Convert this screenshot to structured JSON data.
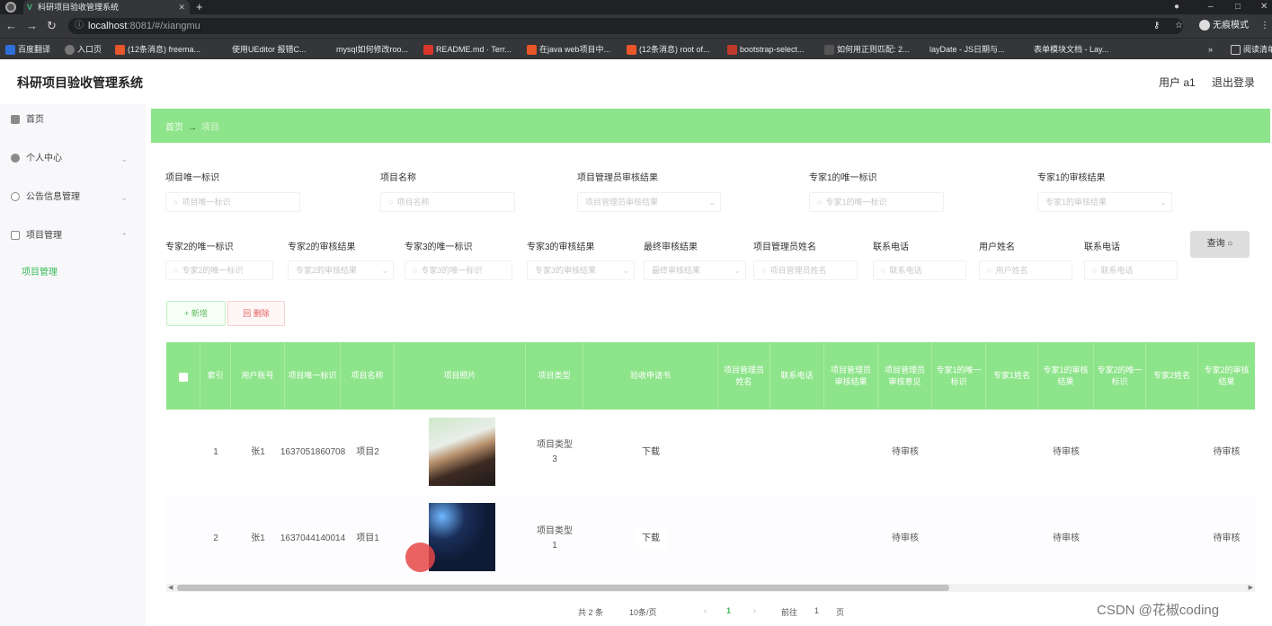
{
  "browser": {
    "tab_title": "科研项目验收管理系统",
    "tab_logo": "V",
    "url_host": "localhost",
    "url_rest": ":8081/#/xiangmu",
    "incognito_label": "无痕模式",
    "bookmarks": [
      {
        "label": "百度翻译",
        "color": "#2f6fd8"
      },
      {
        "label": "入口页",
        "color": "#777777"
      },
      {
        "label": "(12条消息) freema...",
        "color": "#e8562a"
      },
      {
        "label": "使用UEditor 报错C...",
        "color": "#35363a"
      },
      {
        "label": "mysql如何修改roo...",
        "color": "#35363a"
      },
      {
        "label": "README.md · Terr...",
        "color": "#d9362b"
      },
      {
        "label": "在java web项目中...",
        "color": "#e8562a"
      },
      {
        "label": "(12条消息) root of...",
        "color": "#e8562a"
      },
      {
        "label": "bootstrap-select...",
        "color": "#c0392b"
      },
      {
        "label": "如何用正则匹配: 2...",
        "color": "#555555"
      },
      {
        "label": "layDate - JS日期与...",
        "color": "#35363a"
      },
      {
        "label": "表单模块文档 - Lay...",
        "color": "#35363a"
      },
      {
        "label": "阅读清单",
        "color": "#35363a"
      }
    ]
  },
  "header": {
    "title": "科研项目验收管理系统",
    "user": "用户 a1",
    "logout": "退出登录"
  },
  "sidebar": {
    "items": [
      {
        "label": "首页"
      },
      {
        "label": "个人中心"
      },
      {
        "label": "公告信息管理"
      },
      {
        "label": "项目管理"
      }
    ],
    "sub_item": "项目管理"
  },
  "breadcrumb": {
    "home": "首页",
    "arrow": "→",
    "current": "项目"
  },
  "filters": {
    "row1": [
      {
        "label": "项目唯一标识",
        "placeholder": "项目唯一标识"
      },
      {
        "label": "项目名称",
        "placeholder": "项目名称"
      },
      {
        "label": "项目管理员审核结果",
        "placeholder": "项目管理员审核结果"
      },
      {
        "label": "专家1的唯一标识",
        "placeholder": "专家1的唯一标识"
      },
      {
        "label": "专家1的审核结果",
        "placeholder": "专家1的审核结果"
      }
    ],
    "row2": [
      {
        "label": "专家2的唯一标识",
        "placeholder": "专家2的唯一标识"
      },
      {
        "label": "专家2的审核结果",
        "placeholder": "专家2的审核结果"
      },
      {
        "label": "专家3的唯一标识",
        "placeholder": "专家3的唯一标识"
      },
      {
        "label": "专家3的审核结果",
        "placeholder": "专家3的审核结果"
      },
      {
        "label": "最终审核结果",
        "placeholder": "最终审核结果"
      },
      {
        "label": "项目管理员姓名",
        "placeholder": "项目管理员姓名"
      },
      {
        "label": "联系电话",
        "placeholder": "联系电话"
      },
      {
        "label": "用户姓名",
        "placeholder": "用户姓名"
      },
      {
        "label": "联系电话",
        "placeholder": "联系电话"
      }
    ],
    "query_label": "查询 ○"
  },
  "actions": {
    "add": "+ 新增",
    "delete": "回 删除"
  },
  "table": {
    "columns": [
      "索引",
      "用户账号",
      "项目唯一标识",
      "项目名称",
      "项目照片",
      "项目类型",
      "验收申请书",
      "项目管理员姓名",
      "联系电话",
      "项目管理员审核结果",
      "项目管理员审核意见",
      "专家1的唯一标识",
      "专家1姓名",
      "专家1的审核结果",
      "专家2的唯一标识",
      "专家2姓名",
      "专家2的审核结果"
    ],
    "rows": [
      {
        "index": "1",
        "account": "张1",
        "uid": "1637051860708",
        "name": "项目2",
        "type": "项目类型3",
        "download": "下载",
        "admin_result": "待审核",
        "expert1_result": "待审核",
        "expert2_result": "待审核"
      },
      {
        "index": "2",
        "account": "张1",
        "uid": "1637044140014",
        "name": "项目1",
        "type": "项目类型1",
        "download": "下载",
        "admin_result": "待审核",
        "expert1_result": "待审核",
        "expert2_result": "待审核"
      }
    ]
  },
  "pagination": {
    "total": "共 2 条",
    "page_size": "10条/页",
    "current_page": "1",
    "goto_label": "前往",
    "goto_value": "1",
    "page_suffix": "页"
  },
  "watermark": "CSDN @花椒coding"
}
